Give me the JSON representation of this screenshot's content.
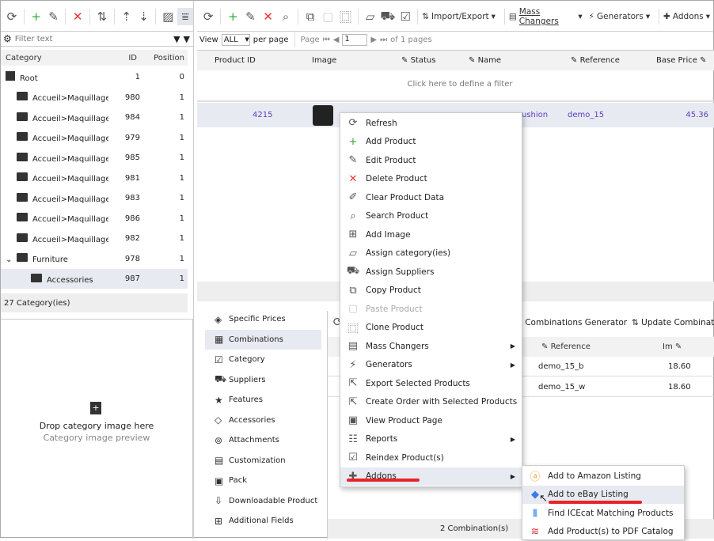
{
  "left_toolbar": {
    "icons": [
      "refresh-icon",
      "add-icon",
      "edit-icon",
      "delete-icon",
      "sort-icon",
      "move-up-icon",
      "move-down-icon",
      "image-icon",
      "filter-icon"
    ]
  },
  "filter": {
    "placeholder": "Filter text"
  },
  "category_grid": {
    "columns": [
      "Category",
      "ID",
      "Position"
    ],
    "rows": [
      {
        "name": "Root",
        "id": "1",
        "position": "0",
        "level": 0
      },
      {
        "name": "Accueil>Maquillage",
        "id": "980",
        "position": "1",
        "level": 1
      },
      {
        "name": "Accueil>Maquillage",
        "id": "984",
        "position": "1",
        "level": 1
      },
      {
        "name": "Accueil>Maquillage",
        "id": "979",
        "position": "1",
        "level": 1
      },
      {
        "name": "Accueil>Maquillage",
        "id": "985",
        "position": "1",
        "level": 1
      },
      {
        "name": "Accueil>Maquillage",
        "id": "981",
        "position": "1",
        "level": 1
      },
      {
        "name": "Accueil>Maquillage",
        "id": "983",
        "position": "1",
        "level": 1
      },
      {
        "name": "Accueil>Maquillage",
        "id": "986",
        "position": "1",
        "level": 1
      },
      {
        "name": "Accueil>Maquillage",
        "id": "982",
        "position": "1",
        "level": 1
      },
      {
        "name": "Furniture",
        "id": "978",
        "position": "1",
        "level": 1
      },
      {
        "name": "Accessories",
        "id": "987",
        "position": "1",
        "level": 2
      }
    ],
    "footer": "27 Category(ies)"
  },
  "image_drop": {
    "title": "Drop category image here",
    "subtitle": "Category image preview"
  },
  "main_toolbar": {
    "import_export": "Import/Export",
    "mass_changers": "Mass Changers",
    "generators": "Generators",
    "addons": "Addons"
  },
  "pager": {
    "view": "View",
    "view_value": "ALL",
    "per_page": "per page",
    "page": "Page",
    "page_value": "1",
    "of_pages": "of 1 pages"
  },
  "product_grid": {
    "columns": [
      "Product ID",
      "Image",
      "Status",
      "Name",
      "Reference",
      "Base Price"
    ],
    "filter_hint": "Click here to define a filter",
    "row": {
      "id": "4215",
      "name": "ushion",
      "reference": "demo_15",
      "price": "45.36"
    }
  },
  "detail_tabs": [
    "Specific Prices",
    "Combinations",
    "Category",
    "Suppliers",
    "Features",
    "Accessories",
    "Attachments",
    "Customization",
    "Pack",
    "Downloadable Product",
    "Additional Fields"
  ],
  "combinations": {
    "toolbar": [
      "ct Combinations Generator",
      "Update Combinati"
    ],
    "columns": [
      "Reference",
      "Im"
    ],
    "rows": [
      {
        "reference": "demo_15_b",
        "value": "18.60"
      },
      {
        "reference": "demo_15_w",
        "value": "18.60"
      }
    ],
    "footer": "2 Combination(s)"
  },
  "context_menu": [
    {
      "label": "Refresh",
      "icon": "refresh-icon"
    },
    {
      "label": "Add Product",
      "icon": "add-icon"
    },
    {
      "label": "Edit Product",
      "icon": "edit-icon"
    },
    {
      "label": "Delete Product",
      "icon": "delete-icon"
    },
    {
      "label": "Clear Product Data",
      "icon": "eraser-icon"
    },
    {
      "label": "Search Product",
      "icon": "search-icon"
    },
    {
      "label": "Add Image",
      "icon": "add-image-icon"
    },
    {
      "label": "Assign category(ies)",
      "icon": "folder-check-icon"
    },
    {
      "label": "Assign Suppliers",
      "icon": "truck-icon"
    },
    {
      "label": "Copy Product",
      "icon": "copy-icon"
    },
    {
      "label": "Paste Product",
      "icon": "paste-icon",
      "disabled": true
    },
    {
      "label": "Clone Product",
      "icon": "clone-icon"
    },
    {
      "label": "Mass Changers",
      "icon": "mass-changers-icon",
      "submenu": true
    },
    {
      "label": "Generators",
      "icon": "lightning-icon",
      "submenu": true
    },
    {
      "label": "Export Selected Products",
      "icon": "export-icon"
    },
    {
      "label": "Create Order with Selected Products",
      "icon": "order-icon"
    },
    {
      "label": "View Product Page",
      "icon": "view-page-icon"
    },
    {
      "label": "Reports",
      "icon": "reports-icon",
      "submenu": true
    },
    {
      "label": "Reindex Product(s)",
      "icon": "reindex-icon"
    },
    {
      "label": "Addons",
      "icon": "puzzle-icon",
      "submenu": true,
      "highlighted": true
    }
  ],
  "addons_submenu": [
    {
      "label": "Add to Amazon Listing",
      "icon": "amazon-icon"
    },
    {
      "label": "Add to eBay Listing",
      "icon": "ebay-icon",
      "highlighted": true
    },
    {
      "label": "Find ICEcat Matching Products",
      "icon": "icecat-icon"
    },
    {
      "label": "Add Product(s) to PDF Catalog",
      "icon": "pdf-catalog-icon"
    }
  ],
  "colors": {
    "link": "#5a3fc0",
    "highlight": "#e8eaf2",
    "annotation": "#e8232a"
  }
}
